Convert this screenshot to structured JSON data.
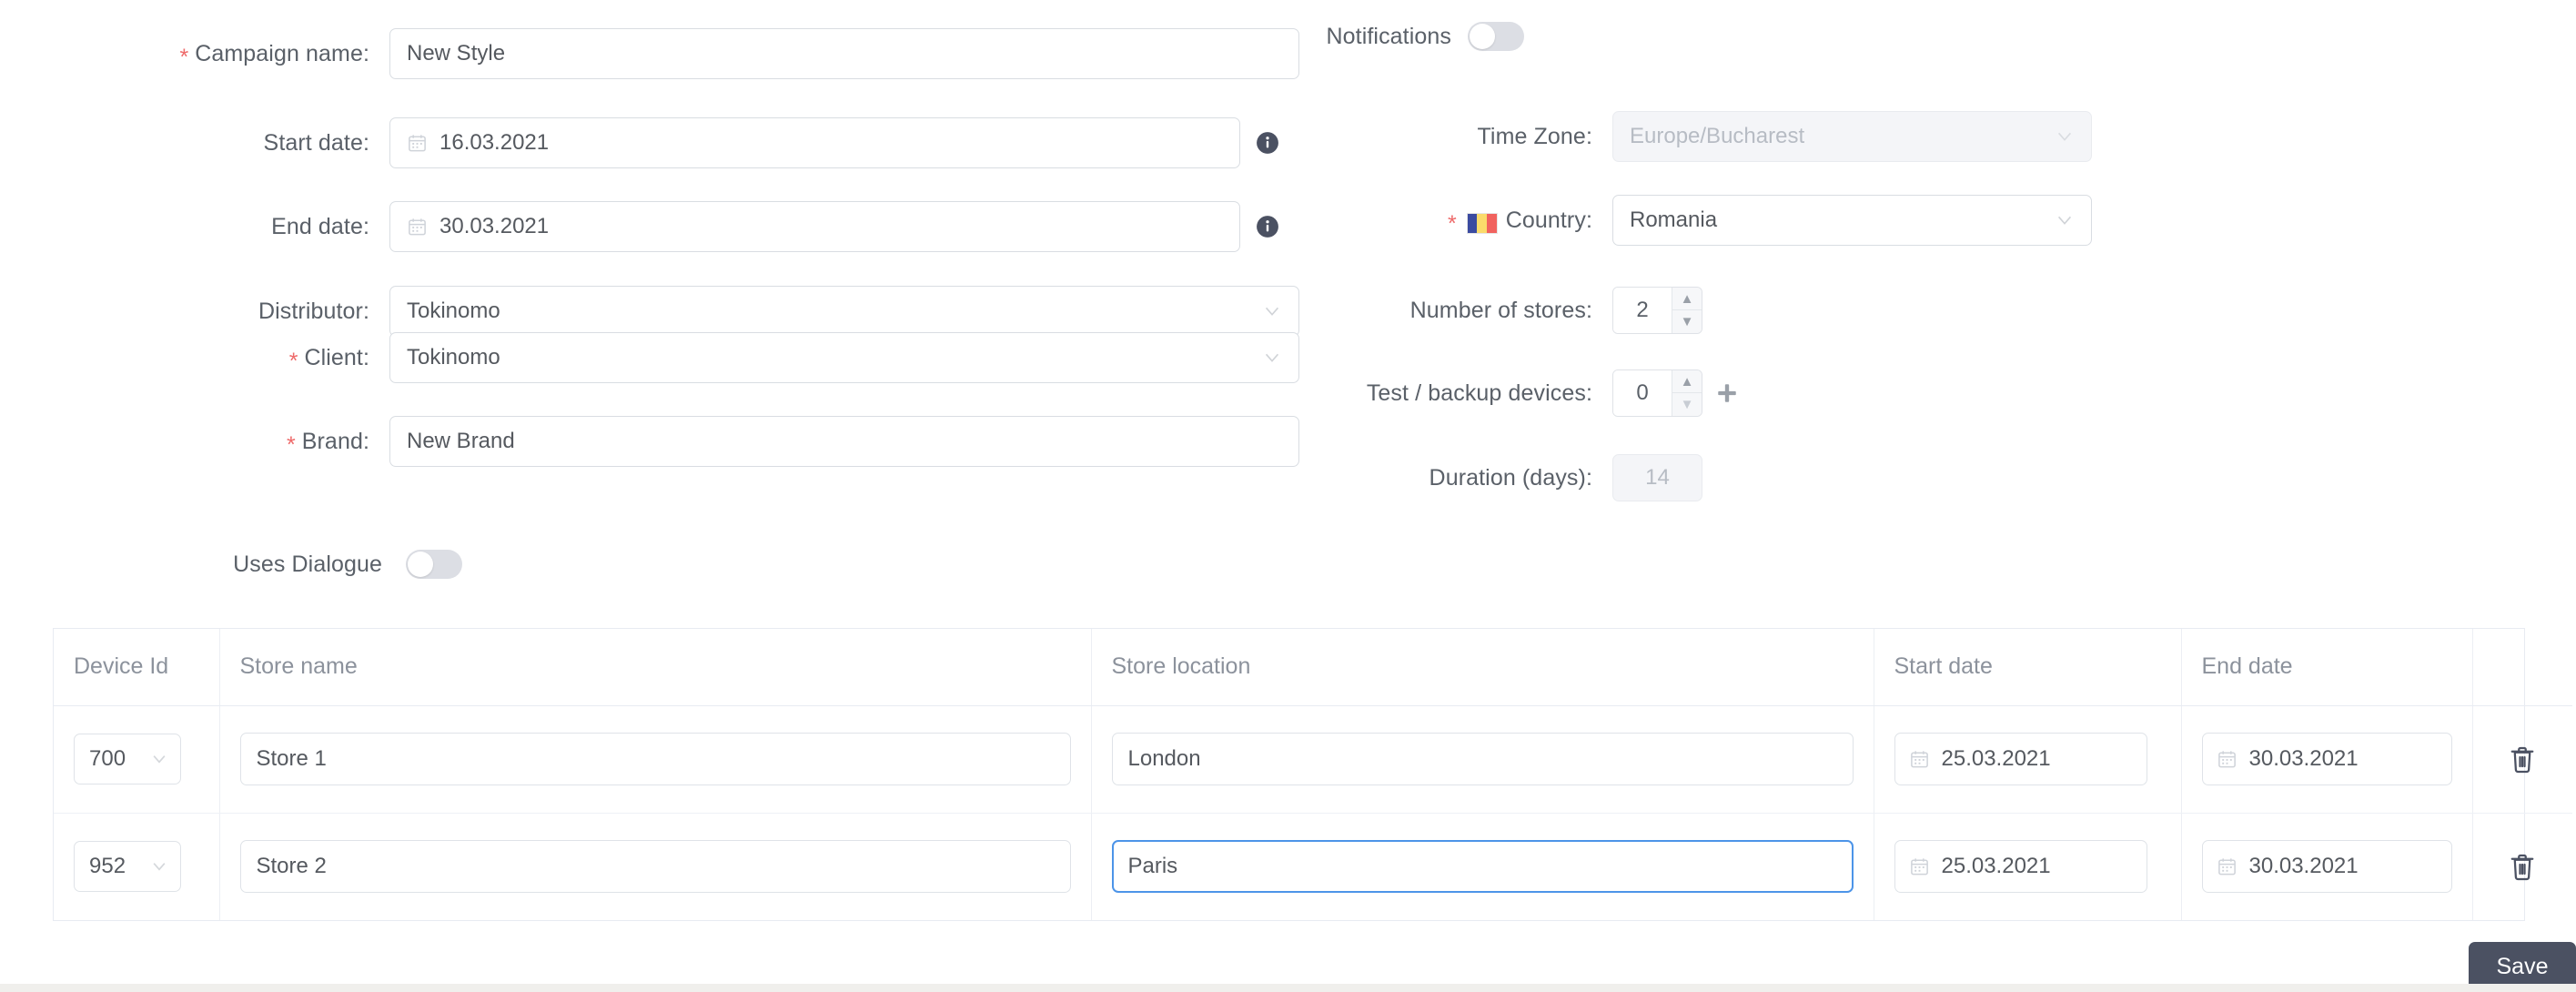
{
  "form": {
    "left": [
      {
        "label": "Campaign name:",
        "required": true,
        "type": "text",
        "value": "New Style"
      },
      {
        "label": "Start date:",
        "required": false,
        "type": "date",
        "value": "16.03.2021",
        "info": true
      },
      {
        "label": "End date:",
        "required": false,
        "type": "date",
        "value": "30.03.2021",
        "info": true
      },
      {
        "label": "Distributor:",
        "required": false,
        "type": "select",
        "value": "Tokinomo"
      },
      {
        "label": "Client:",
        "required": true,
        "type": "select",
        "value": "Tokinomo"
      },
      {
        "label": "Brand:",
        "required": true,
        "type": "text",
        "value": "New Brand"
      },
      {
        "label": "Uses Dialogue",
        "required": false,
        "type": "toggle",
        "value": "off"
      }
    ],
    "right": [
      {
        "label": "Notifications",
        "required": false,
        "type": "toggle",
        "value": "off"
      },
      {
        "label": "Time Zone:",
        "required": false,
        "type": "select",
        "value": "Europe/Bucharest",
        "disabled": true
      },
      {
        "label": "Country:",
        "required": true,
        "type": "select",
        "value": "Romania",
        "flag": "romania-flag-icon"
      },
      {
        "label": "Number of stores:",
        "required": false,
        "type": "stepper",
        "value": "2"
      },
      {
        "label": "Test / backup devices:",
        "required": false,
        "type": "stepper",
        "value": "0",
        "plus": true
      },
      {
        "label": "Duration (days):",
        "required": false,
        "type": "text",
        "value": "14",
        "disabled": true
      }
    ]
  },
  "table": {
    "headers": [
      "Device Id",
      "Store name",
      "Store location",
      "Start date",
      "End date",
      ""
    ],
    "rows": [
      {
        "device_id": "700",
        "store_name": "Store 1",
        "store_location": "London",
        "start_date": "25.03.2021",
        "end_date": "30.03.2021",
        "location_focused": false
      },
      {
        "device_id": "952",
        "store_name": "Store 2",
        "store_location": "Paris",
        "start_date": "25.03.2021",
        "end_date": "30.03.2021",
        "location_focused": true
      }
    ]
  },
  "footer": {
    "save_label": "Save"
  },
  "colors": {
    "accent_focus": "#4c94e8",
    "required_star": "#ee6a6a",
    "save_bg": "#4b5162",
    "label_text": "#5a6068",
    "value_text": "#55595f",
    "border": "#dfe3e8"
  }
}
